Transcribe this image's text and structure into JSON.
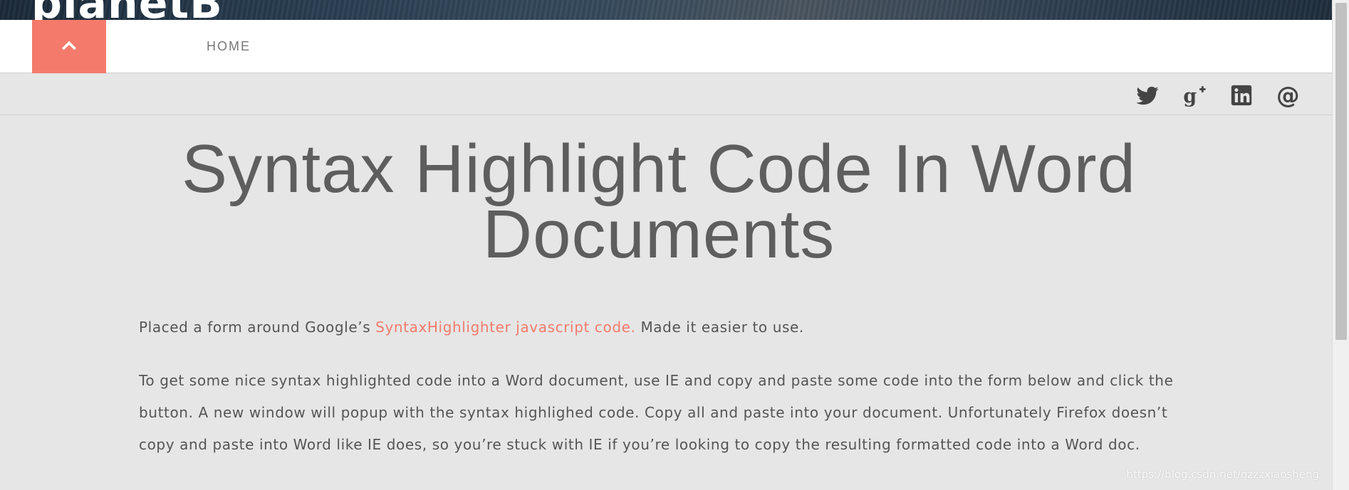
{
  "header": {
    "site_name": "planetB"
  },
  "nav": {
    "toggle_icon": "chevron-up-icon",
    "home_label": "HOME"
  },
  "social": {
    "icons": [
      "twitter-icon",
      "google-plus-icon",
      "linkedin-icon",
      "email-at-icon"
    ]
  },
  "article": {
    "title": "Syntax Highlight Code In Word Documents",
    "intro_before": "Placed a form around Google’s ",
    "intro_link": "SyntaxHighlighter javascript code.",
    "intro_after": " Made it easier to use.",
    "body": "To get some nice syntax highlighted code into a Word document, use IE and copy and paste some code into the form below and click the button. A new window will popup with the syntax highlighed code. Copy all and paste into your document. Unfortunately Firefox doesn’t copy and paste into Word like IE does, so you’re stuck with IE if you’re looking to copy the resulting formatted code into a Word doc."
  },
  "watermark": "https://blog.csdn.net/qzzzxiaosheng",
  "colors": {
    "accent": "#f47b6b",
    "text": "#555555",
    "background": "#e6e6e6"
  }
}
